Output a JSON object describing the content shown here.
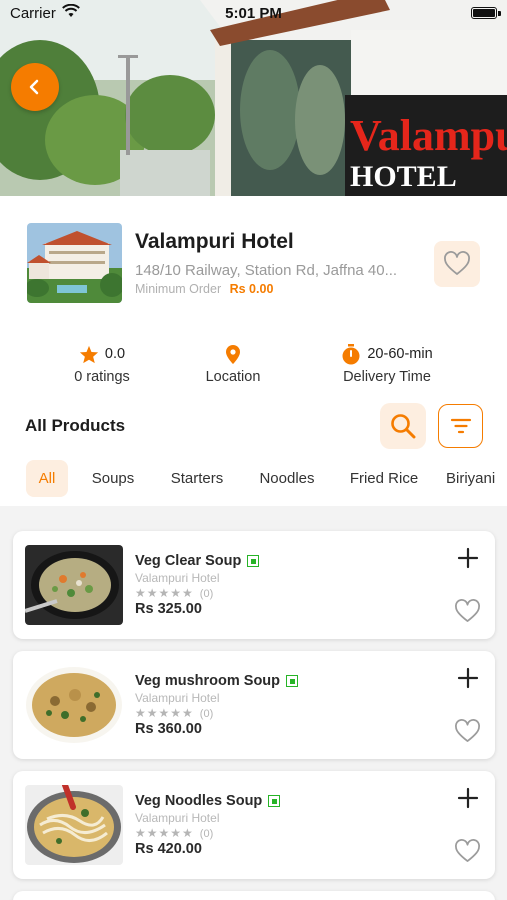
{
  "status_bar": {
    "carrier": "Carrier",
    "time": "5:01 PM"
  },
  "hotel": {
    "name": "Valampuri Hotel",
    "address": "148/10 Railway, Station Rd, Jaffna 40...",
    "min_order_label": "Minimum Order",
    "min_order_value": "Rs 0.00",
    "sign_text": "Valampuri",
    "sign_subtext": "HOTEL"
  },
  "stats": {
    "rating_value": "0.0",
    "rating_label": "0 ratings",
    "location_label": "Location",
    "delivery_value": "20-60-min",
    "delivery_label": "Delivery Time"
  },
  "products_header": {
    "title": "All Products"
  },
  "tabs": [
    {
      "label": "All",
      "active": true
    },
    {
      "label": "Soups",
      "active": false
    },
    {
      "label": "Starters",
      "active": false
    },
    {
      "label": "Noodles",
      "active": false
    },
    {
      "label": "Fried Rice",
      "active": false
    },
    {
      "label": "Biriyani",
      "active": false
    }
  ],
  "products": [
    {
      "name": "Veg Clear Soup",
      "hotel": "Valampuri Hotel",
      "rating_count": "(0)",
      "price": "Rs 325.00",
      "stars": "★★★★★"
    },
    {
      "name": "Veg mushroom Soup",
      "hotel": "Valampuri Hotel",
      "rating_count": "(0)",
      "price": "Rs 360.00",
      "stars": "★★★★★"
    },
    {
      "name": "Veg Noodles Soup",
      "hotel": "Valampuri Hotel",
      "rating_count": "(0)",
      "price": "Rs 420.00",
      "stars": "★★★★★"
    }
  ],
  "colors": {
    "accent": "#f57c00",
    "accent_light": "#fdeee0",
    "veg": "#27b427"
  },
  "icons": {
    "back": "chevron-left-icon",
    "favorite": "heart-outline-icon",
    "rating": "star-icon",
    "location": "map-pin-icon",
    "delivery": "timer-icon",
    "search": "search-icon",
    "filter": "filter-icon",
    "add": "plus-icon"
  }
}
